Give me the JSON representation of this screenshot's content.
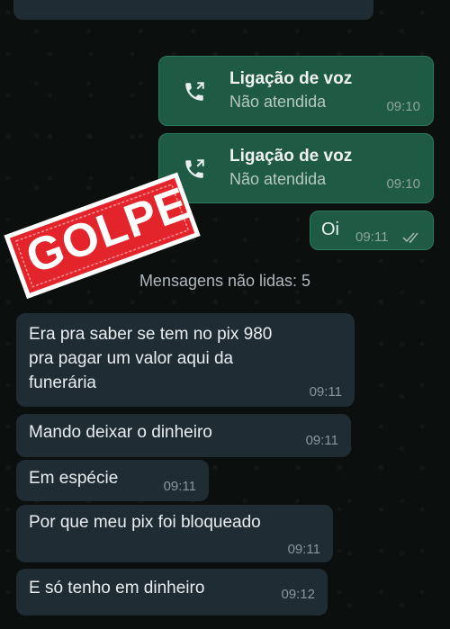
{
  "calls": [
    {
      "title": "Ligação de voz",
      "status": "Não atendida",
      "time": "09:10"
    },
    {
      "title": "Ligação de voz",
      "status": "Não atendida",
      "time": "09:10"
    }
  ],
  "sent_message": {
    "text": "Oi",
    "time": "09:11"
  },
  "unread_divider": "Mensagens não lidas: 5",
  "stamp_text": "GOLPE",
  "incoming": [
    {
      "lines": [
        "Era pra saber se tem no pix 980",
        "pra pagar um valor aqui da",
        "funerária"
      ],
      "time": "09:11"
    },
    {
      "lines": [
        "Mando deixar o dinheiro"
      ],
      "time": "09:11"
    },
    {
      "lines": [
        "Em espécie"
      ],
      "time": "09:11"
    },
    {
      "lines": [
        "Por que meu pix foi bloqueado"
      ],
      "time": "09:11"
    },
    {
      "lines": [
        "E só tenho em dinheiro"
      ],
      "time": "09:12"
    }
  ],
  "colors": {
    "outgoing": "#1e5a44",
    "incoming": "#1f2c34",
    "stamp": "#e3242b"
  }
}
